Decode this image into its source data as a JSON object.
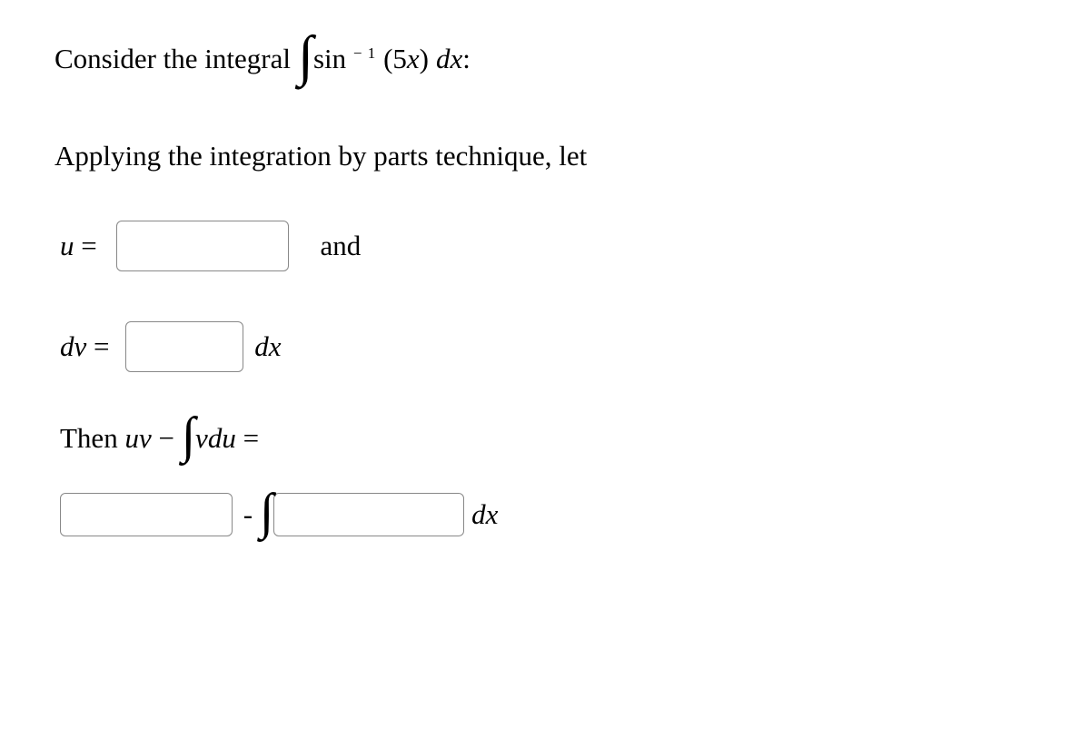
{
  "prompt": {
    "prefix": "Consider the integral ",
    "integrand_prefix": "sin",
    "integrand_exponent": "− 1",
    "integrand_arg": "(5",
    "integrand_var": "x",
    "integrand_arg_close": ")",
    "dx_d": " d",
    "dx_x": "x",
    "colon": ":"
  },
  "line2": "Applying the integration by parts technique, let",
  "u_line": {
    "u": "u",
    "equals": " = ",
    "and": "and"
  },
  "dv_line": {
    "dv_d": "d",
    "dv_v": "v",
    "equals": " = ",
    "dx_d": "d",
    "dx_x": "x"
  },
  "then_line": {
    "then": "Then ",
    "uv_u": "u",
    "uv_v": "v",
    "minus": " − ",
    "vdu_v": "v",
    "vdu_d": "d",
    "vdu_u": "u",
    "equals": " ="
  },
  "answer_line": {
    "minus": " - ",
    "dx_d": "d",
    "dx_x": "x"
  }
}
